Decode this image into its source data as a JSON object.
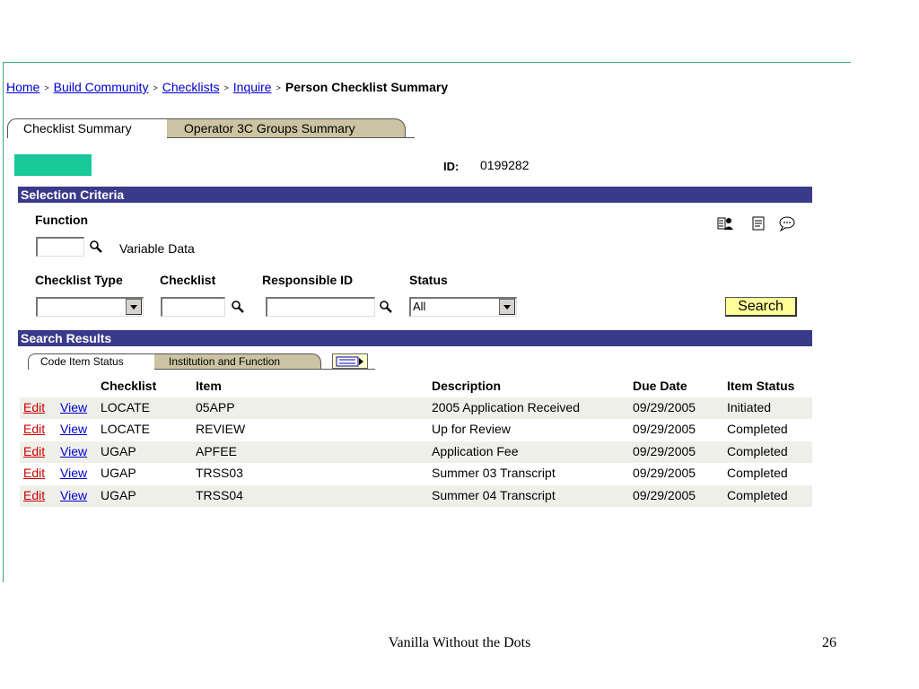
{
  "breadcrumb": {
    "items": [
      "Home",
      "Build Community",
      "Checklists",
      "Inquire"
    ],
    "current": "Person Checklist Summary"
  },
  "tabs": [
    "Checklist Summary",
    "Operator 3C Groups Summary"
  ],
  "id_label": "ID:",
  "id_value": "0199282",
  "selection_criteria": {
    "title": "Selection Criteria",
    "function_label": "Function",
    "function_value": "",
    "variable_data": "Variable Data",
    "checklist_type_label": "Checklist Type",
    "checklist_label": "Checklist",
    "responsible_id_label": "Responsible ID",
    "status_label": "Status",
    "status_value": "All",
    "search_label": "Search"
  },
  "search_results": {
    "title": "Search Results",
    "tabs": [
      "Code Item Status",
      "Institution and Function"
    ],
    "columns": {
      "checklist": "Checklist",
      "item": "Item",
      "description": "Description",
      "due_date": "Due Date",
      "item_status": "Item Status"
    },
    "edit_label": "Edit",
    "view_label": "View",
    "rows": [
      {
        "checklist": "LOCATE",
        "item": "05APP",
        "description": "2005 Application Received",
        "due_date": "09/29/2005",
        "status": "Initiated"
      },
      {
        "checklist": "LOCATE",
        "item": "REVIEW",
        "description": "Up for Review",
        "due_date": "09/29/2005",
        "status": "Completed"
      },
      {
        "checklist": "UGAP",
        "item": "APFEE",
        "description": "Application Fee",
        "due_date": "09/29/2005",
        "status": "Completed"
      },
      {
        "checklist": "UGAP",
        "item": "TRSS03",
        "description": "Summer 03 Transcript",
        "due_date": "09/29/2005",
        "status": "Completed"
      },
      {
        "checklist": "UGAP",
        "item": "TRSS04",
        "description": "Summer 04 Transcript",
        "due_date": "09/29/2005",
        "status": "Completed"
      }
    ]
  },
  "footer": {
    "title": "Vanilla Without the Dots",
    "page": "26"
  },
  "icons": [
    "lookup-icon",
    "dropdown-arrow-icon",
    "people-icon",
    "notepad-icon",
    "comment-icon",
    "view-all-icon"
  ],
  "colors": {
    "section_bar": "#3a3a8a",
    "teal": "#19c99a",
    "tab_inactive": "#cbc3a1",
    "search_button": "#ffff99",
    "row_shade": "#efefea",
    "link": "#0000cc",
    "edit_link": "#cc0000"
  }
}
